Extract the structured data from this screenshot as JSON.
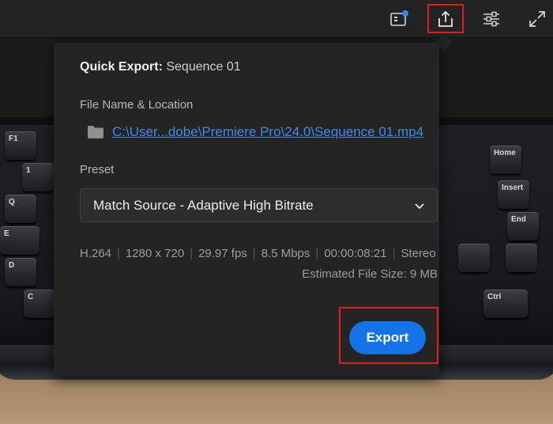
{
  "toolbar": {
    "buttons": [
      {
        "icon": "captions-icon",
        "badge_color": "#2a8cf0"
      },
      {
        "icon": "share-export-icon",
        "highlighted": true
      },
      {
        "icon": "sliders-icon"
      },
      {
        "icon": "fullscreen-icon"
      }
    ]
  },
  "quick_export": {
    "title_label": "Quick Export:",
    "title_value": "Sequence 01",
    "file_label": "File Name & Location",
    "file_path": "C:\\User...dobe\\Premiere Pro\\24.0\\Sequence 01.mp4",
    "preset_label": "Preset",
    "preset_value": "Match Source - Adaptive High Bitrate",
    "meta": {
      "codec": "H.264",
      "resolution": "1280 x 720",
      "fps": "29.97 fps",
      "bitrate": "8.5 Mbps",
      "duration": "00:00:08:21",
      "audio": "Stereo"
    },
    "estimated_size": "Estimated File Size: 9 MB",
    "export_label": "Export"
  },
  "keyboard_keys": [
    "F1",
    "1",
    "Q",
    "E",
    "D",
    "C",
    "Ctrl",
    "Home",
    "Insert",
    "End"
  ],
  "colors": {
    "accent": "#1473e6",
    "link": "#3f8bea",
    "highlight": "#e21d1d",
    "panel": "#242424"
  }
}
